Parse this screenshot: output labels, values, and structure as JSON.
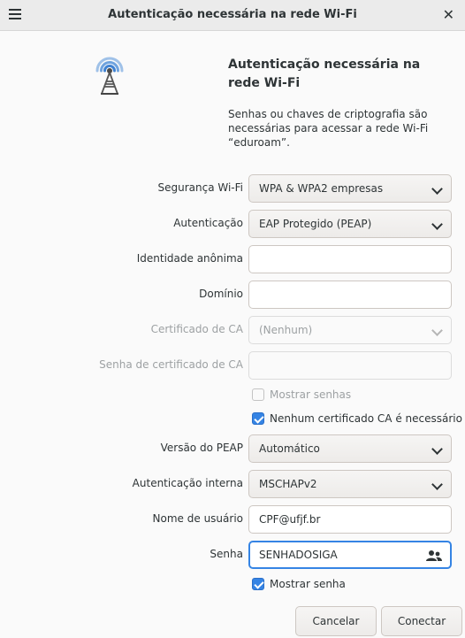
{
  "window": {
    "title": "Autenticação necessária na rede Wi-Fi"
  },
  "header": {
    "heading": "Autenticação necessária na rede Wi-Fi",
    "description": "Senhas ou chaves de criptografia são necessárias para acessar a rede Wi-Fi “eduroam”.",
    "icon": "wifi-tower-icon"
  },
  "form": {
    "security": {
      "label": "Segurança Wi-Fi",
      "value": "WPA & WPA2 empresas"
    },
    "authentication": {
      "label": "Autenticação",
      "value": "EAP Protegido (PEAP)"
    },
    "anonymous_identity": {
      "label": "Identidade anônima",
      "value": ""
    },
    "domain": {
      "label": "Domínio",
      "value": ""
    },
    "ca_certificate": {
      "label": "Certificado de CA",
      "value": "(Nenhum)",
      "enabled": false
    },
    "ca_certificate_password": {
      "label": "Senha de certificado de CA",
      "value": "",
      "enabled": false
    },
    "show_passwords": {
      "label": "Mostrar senhas",
      "checked": false,
      "enabled": false
    },
    "no_ca_required": {
      "label": "Nenhum certificado CA é necessário",
      "checked": true
    },
    "peap_version": {
      "label": "Versão do PEAP",
      "value": "Automático"
    },
    "inner_auth": {
      "label": "Autenticação interna",
      "value": "MSCHAPv2"
    },
    "username": {
      "label": "Nome de usuário",
      "value": "CPF@ufjf.br"
    },
    "password": {
      "label": "Senha",
      "value": "SENHADOSIGA",
      "icon": "users-icon"
    },
    "show_password": {
      "label": "Mostrar senha",
      "checked": true
    }
  },
  "buttons": {
    "cancel": "Cancelar",
    "connect": "Conectar"
  },
  "colors": {
    "accent": "#3584e4",
    "titlebar": "#ebebeb",
    "background": "#fafafa"
  }
}
